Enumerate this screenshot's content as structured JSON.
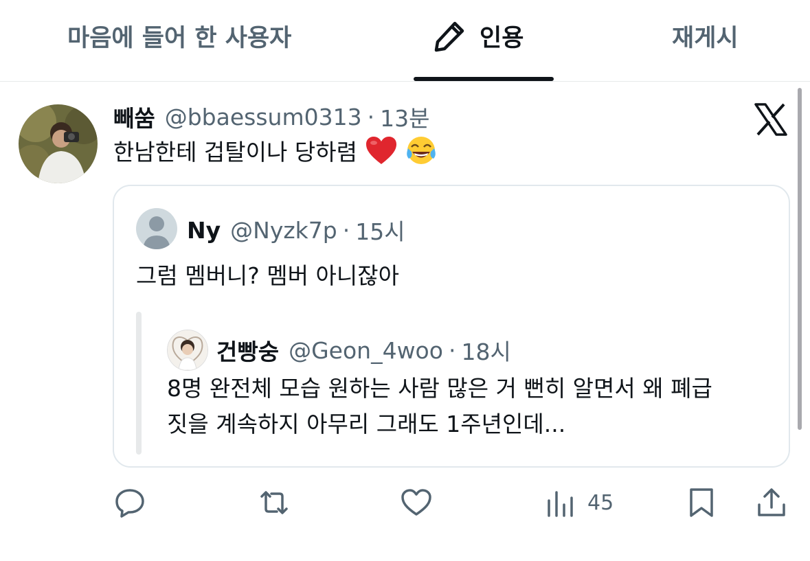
{
  "tabs": [
    {
      "label": "마음에 들어 한 사용자",
      "active": false
    },
    {
      "label": "인용",
      "active": true,
      "icon": "pencil-icon"
    },
    {
      "label": "재게시",
      "active": false
    }
  ],
  "tweet": {
    "display_name": "빼쑴",
    "handle": "@bbaessum0313",
    "separator": "·",
    "time": "13분",
    "text": "한남한테 겁탈이나 당하렴",
    "emojis": [
      "red-heart-emoji",
      "tears-of-joy-emoji"
    ],
    "platform_icon": "x-logo-icon"
  },
  "quote": {
    "display_name": "Ny",
    "handle": "@Nyzk7p",
    "separator": "·",
    "time": "15시",
    "text": "그럼 멤버니? 멤버 아니잖아",
    "nested": {
      "display_name": "건빵숭",
      "handle": "@Geon_4woo",
      "separator": "·",
      "time": "18시",
      "line1": "8명 완전체 모습 원하는 사람 많은 거 뻔히 알면서 왜 폐급",
      "line2": "짓을 계속하지 아무리 그래도 1주년인데..."
    }
  },
  "actions": {
    "views_count": "45"
  },
  "colors": {
    "text": "#0f1419",
    "muted": "#536471",
    "border": "#e1e8ed",
    "heart_emoji": "#e0262e"
  }
}
